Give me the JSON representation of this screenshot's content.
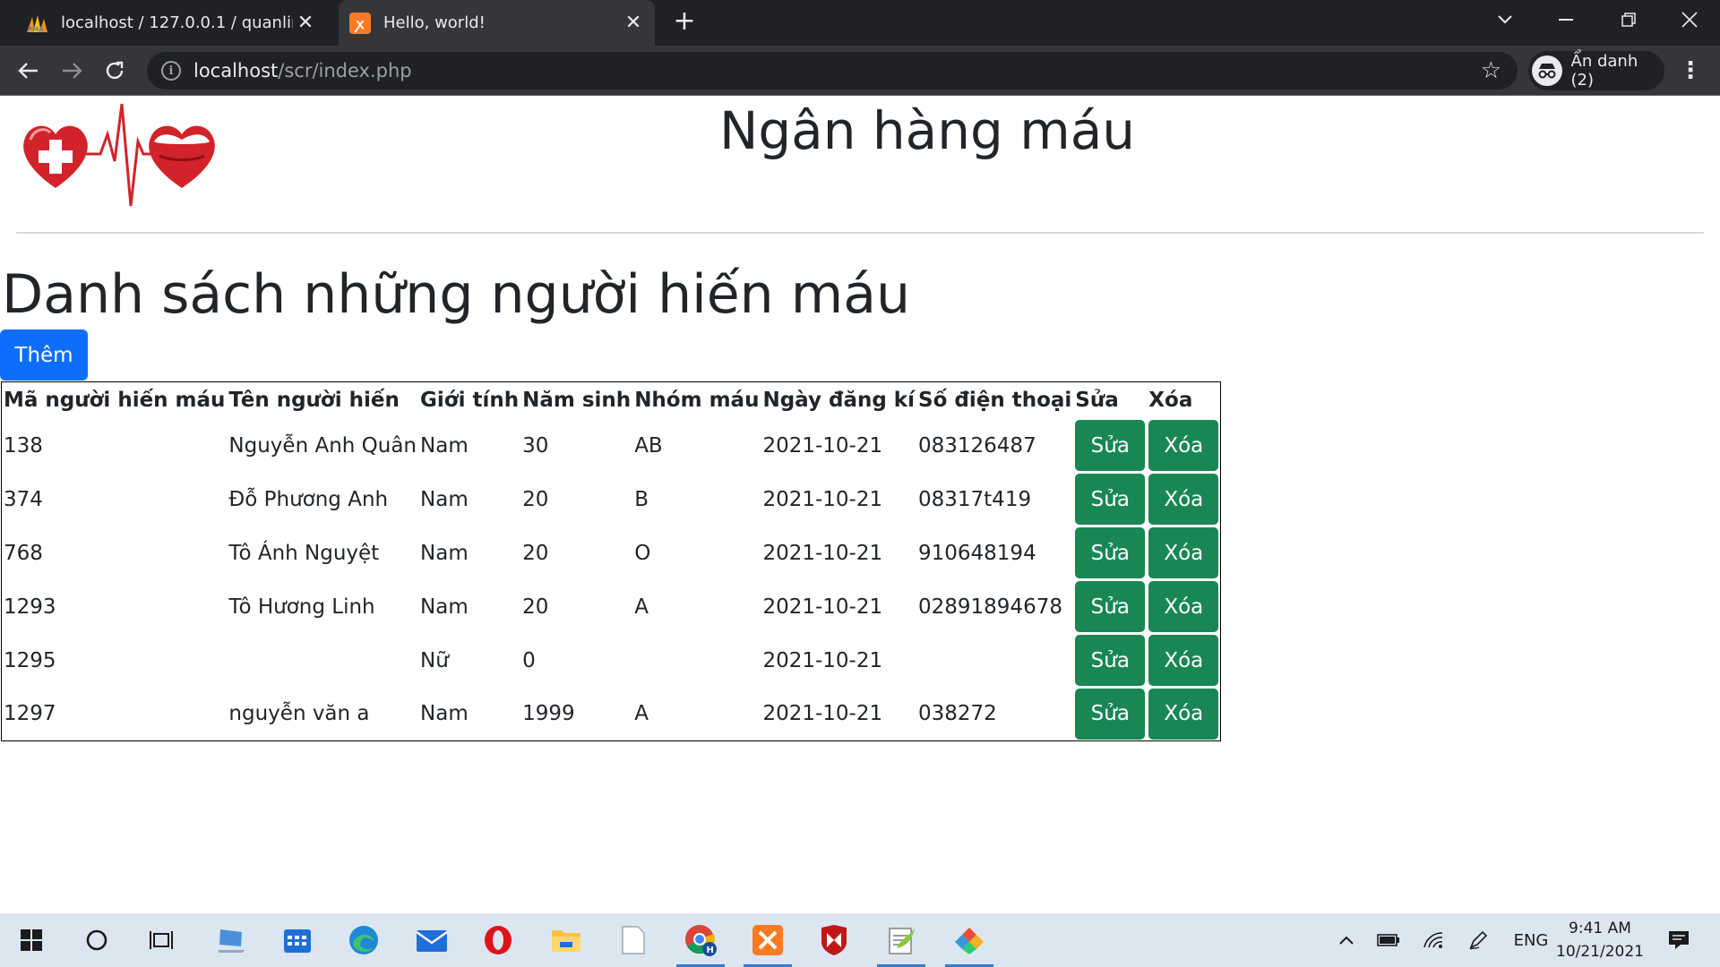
{
  "browser": {
    "tabs": [
      {
        "title": "localhost / 127.0.0.1 / quanlingan",
        "icon": "phpmyadmin-icon",
        "active": false
      },
      {
        "title": "Hello, world!",
        "icon": "xampp-icon",
        "active": true
      }
    ],
    "url_host": "localhost",
    "url_path": "/scr/index.php",
    "profile_label": "Ẩn danh (2)"
  },
  "page": {
    "site_title": "Ngân hàng máu",
    "heading": "Danh sách những người hiến máu",
    "add_button": "Thêm",
    "columns": [
      "Mã người hiến máu",
      "Tên người hiến",
      "Giới tính",
      "Năm sinh",
      "Nhóm máu",
      "Ngày đăng kí",
      "Số điện thoại",
      "Sửa",
      "Xóa"
    ],
    "edit_label": "Sửa",
    "delete_label": "Xóa",
    "rows": [
      [
        "138",
        "Nguyễn Anh Quân",
        "Nam",
        "30",
        "AB",
        "2021-10-21",
        "083126487"
      ],
      [
        "374",
        "Đỗ Phương Anh",
        "Nam",
        "20",
        "B",
        "2021-10-21",
        "08317t419"
      ],
      [
        "768",
        "Tô Ánh Nguyệt",
        "Nam",
        "20",
        "O",
        "2021-10-21",
        "910648194"
      ],
      [
        "1293",
        "Tô Hương Linh",
        "Nam",
        "20",
        "A",
        "2021-10-21",
        "02891894678"
      ],
      [
        "1295",
        "",
        "Nữ",
        "0",
        "",
        "2021-10-21",
        ""
      ],
      [
        "1297",
        "nguyễn văn a",
        "Nam",
        "1999",
        "A",
        "2021-10-21",
        "038272"
      ]
    ]
  },
  "taskbar": {
    "language": "ENG",
    "time": "9:41 AM",
    "date": "10/21/2021"
  },
  "colors": {
    "primary_button": "#0d6efd",
    "success_button": "#198754",
    "chrome_dark": "#202124",
    "chrome_toolbar": "#35363a"
  }
}
